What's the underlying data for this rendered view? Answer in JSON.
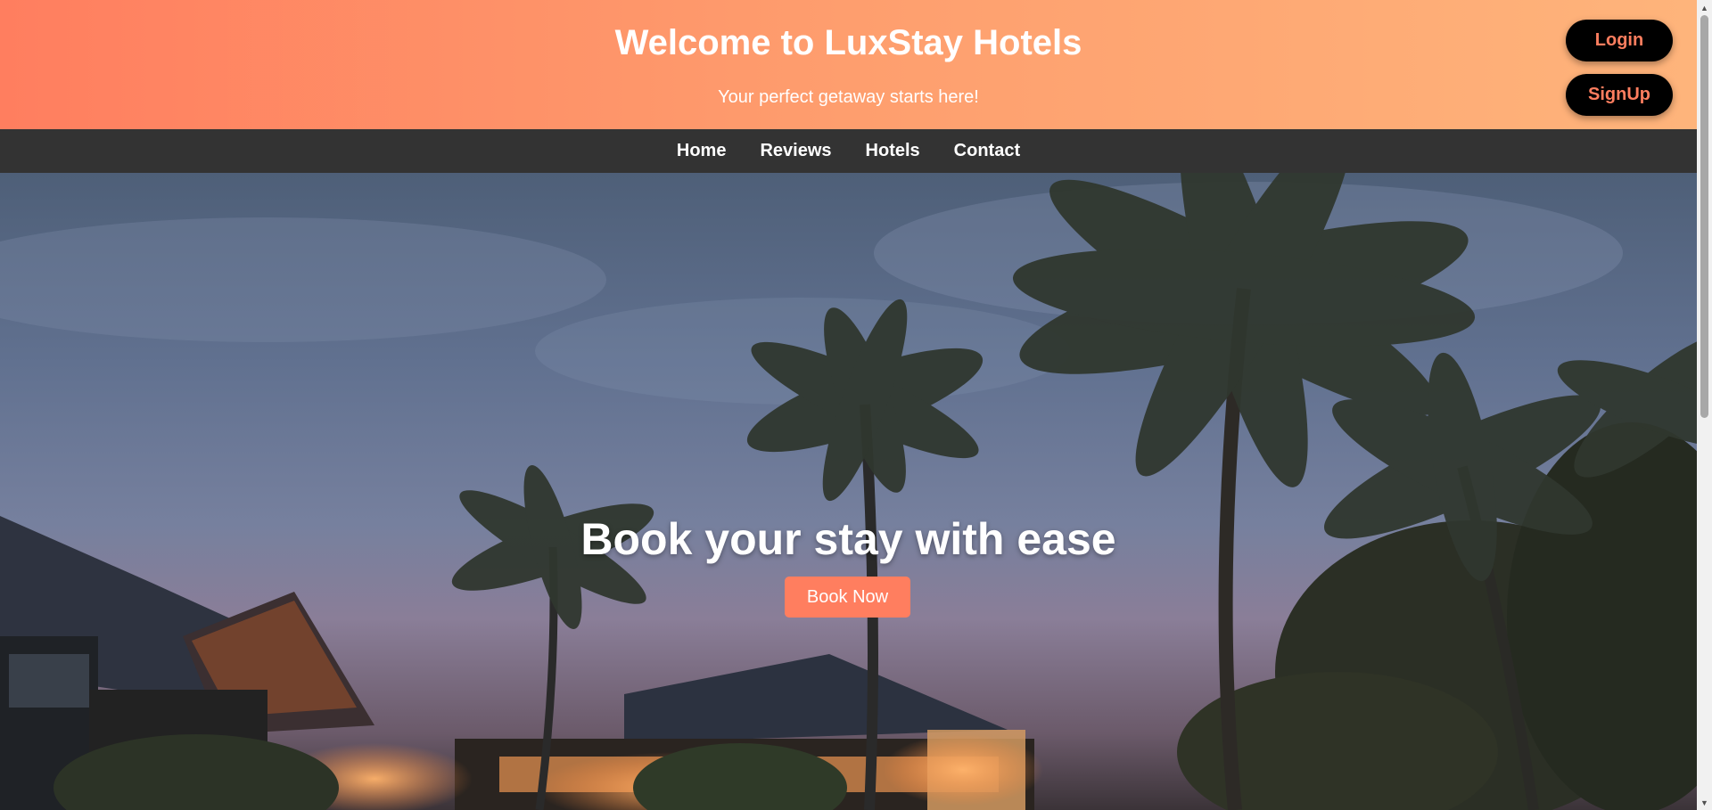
{
  "header": {
    "title": "Welcome to LuxStay Hotels",
    "subtitle": "Your perfect getaway starts here!",
    "login_label": "Login",
    "signup_label": "SignUp"
  },
  "nav": {
    "items": [
      {
        "label": "Home"
      },
      {
        "label": "Reviews"
      },
      {
        "label": "Hotels"
      },
      {
        "label": "Contact"
      }
    ]
  },
  "hero": {
    "title": "Book your stay with ease",
    "cta_label": "Book Now",
    "image": "tropical-resort-palm-trees-dusk"
  },
  "icons": {
    "scroll_up": "scroll-up-arrow-icon",
    "scroll_down": "scroll-down-arrow-icon"
  },
  "colors": {
    "header_gradient_start": "#ff7e5f",
    "header_gradient_end": "#feb47b",
    "nav_bg": "#333333",
    "accent": "#ff7e5f",
    "auth_button_bg": "#000000"
  }
}
